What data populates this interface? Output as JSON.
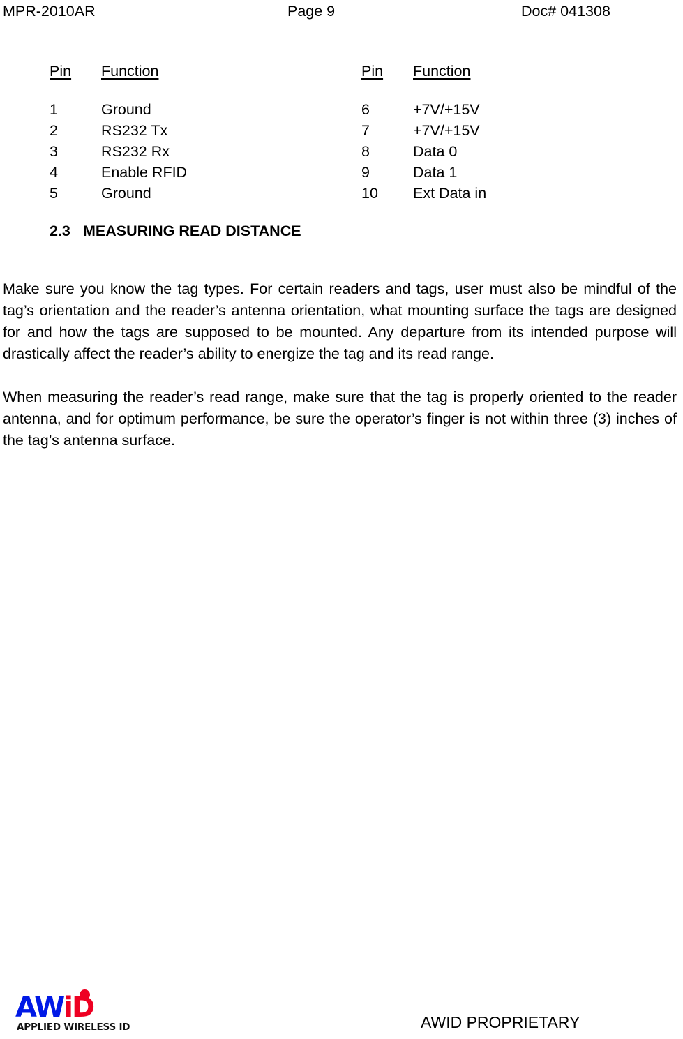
{
  "header": {
    "left": "MPR-2010AR",
    "center": "Page 9",
    "right": "Doc# 041308"
  },
  "pin_tables": {
    "columns": [
      "Pin",
      "Function"
    ],
    "left_table": {
      "header_pin": "Pin",
      "header_function": "Function",
      "rows": [
        {
          "pin": "1",
          "function": "Ground"
        },
        {
          "pin": "2",
          "function": "RS232 Tx"
        },
        {
          "pin": "3",
          "function": "RS232 Rx"
        },
        {
          "pin": "4",
          "function": "Enable RFID"
        },
        {
          "pin": "5",
          "function": "Ground"
        }
      ]
    },
    "right_table": {
      "header_pin": "Pin",
      "header_function": "Function",
      "rows": [
        {
          "pin": "6",
          "function": "+7V/+15V"
        },
        {
          "pin": "7",
          "function": "+7V/+15V"
        },
        {
          "pin": "8",
          "function": "Data 0"
        },
        {
          "pin": "9",
          "function": "Data 1"
        },
        {
          "pin": "10",
          "function": "Ext Data in"
        }
      ]
    }
  },
  "section": {
    "number": "2.3",
    "title": "MEASURING READ DISTANCE"
  },
  "paragraphs": [
    "Make sure you know the tag types. For certain readers and tags, user must also be mindful of the tag’s orientation and the reader’s antenna orientation, what mounting surface the tags are designed for and how the tags are supposed to be mounted. Any departure from its intended purpose will drastically affect the reader’s ability to energize the tag and its read range.",
    "When measuring the reader’s read range, make sure that the tag is properly oriented to the reader antenna, and for optimum performance, be sure the operator’s finger is not within three (3) inches of the tag’s antenna surface."
  ],
  "footer": {
    "logo": {
      "word_part_1": "AW",
      "word_part_2": "iD",
      "tagline": "APPLIED WIRELESS ID",
      "color_blue": "#0019e6",
      "color_red": "#ee0022"
    },
    "proprietary_text": "AWID PROPRIETARY"
  }
}
